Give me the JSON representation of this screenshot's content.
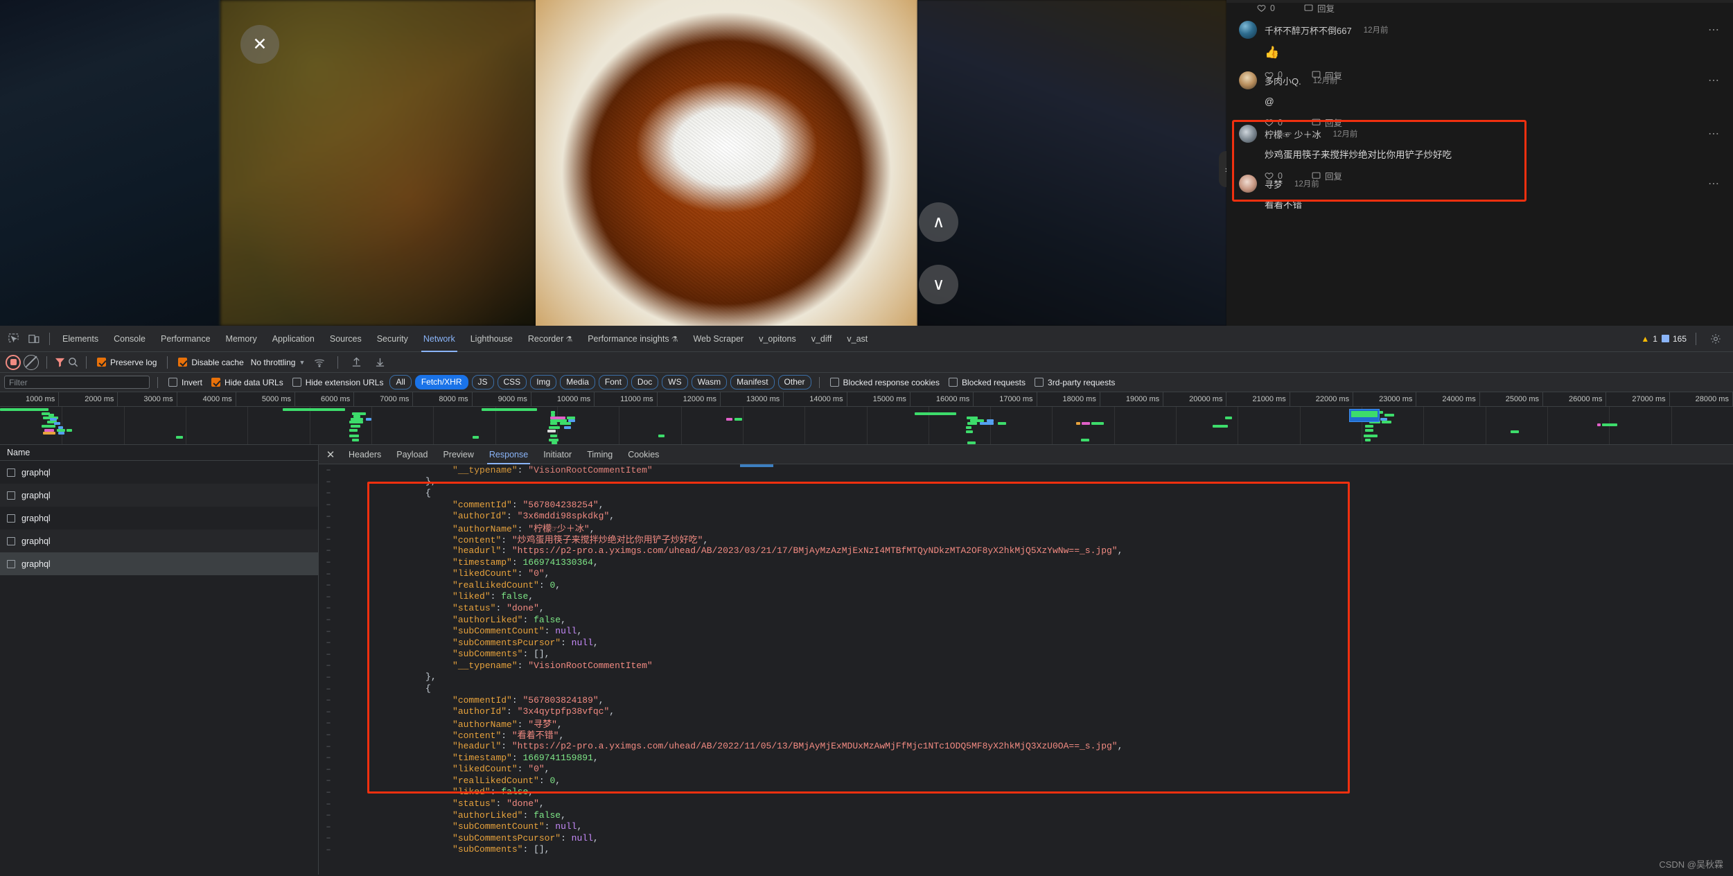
{
  "viewer": {
    "close_label": "✕",
    "prev_label": "∧",
    "next_label": "∨",
    "panel_toggle_label": "›"
  },
  "comments": {
    "items": [
      {
        "name": "",
        "time": "",
        "body": "",
        "likes": "0",
        "reply": "回复",
        "partial": true
      },
      {
        "name": "千杯不醉万杯不倒667",
        "time": "12月前",
        "body": "👍",
        "likes": "0",
        "reply": "回复",
        "more": "⋯"
      },
      {
        "name": "多肉小Q.",
        "time": "12月前",
        "body": "@",
        "likes": "0",
        "reply": "回复",
        "more": "⋯"
      },
      {
        "name": "柠檬☞ 少＋冰",
        "time": "12月前",
        "body": "炒鸡蛋用筷子来搅拌炒绝对比你用铲子炒好吃",
        "likes": "0",
        "reply": "回复",
        "more": "⋯"
      },
      {
        "name": "寻梦",
        "time": "12月前",
        "body": "看着不错",
        "likes": "",
        "reply": "",
        "more": "⋯"
      }
    ],
    "highlight_color": "#f0300f"
  },
  "devtools": {
    "tabs": [
      {
        "label": "Elements",
        "active": false
      },
      {
        "label": "Console",
        "active": false
      },
      {
        "label": "Performance",
        "active": false
      },
      {
        "label": "Memory",
        "active": false
      },
      {
        "label": "Application",
        "active": false
      },
      {
        "label": "Sources",
        "active": false
      },
      {
        "label": "Security",
        "active": false
      },
      {
        "label": "Network",
        "active": true
      },
      {
        "label": "Lighthouse",
        "active": false
      },
      {
        "label": "Recorder",
        "active": false,
        "flask": true
      },
      {
        "label": "Performance insights",
        "active": false,
        "flask": true
      },
      {
        "label": "Web Scraper",
        "active": false
      },
      {
        "label": "v_opitons",
        "active": false
      },
      {
        "label": "v_diff",
        "active": false
      },
      {
        "label": "v_ast",
        "active": false
      }
    ],
    "status": {
      "warning_count": "1",
      "message_count": "165"
    },
    "toolbar": {
      "preserve_log": "Preserve log",
      "preserve_log_checked": true,
      "disable_cache": "Disable cache",
      "disable_cache_checked": true,
      "throttling": "No throttling"
    },
    "filterbar": {
      "filter_placeholder": "Filter",
      "filter_value": "",
      "invert": "Invert",
      "invert_checked": false,
      "hide_data_urls": "Hide data URLs",
      "hide_data_urls_checked": true,
      "hide_extension_urls": "Hide extension URLs",
      "hide_extension_urls_checked": false,
      "types": [
        {
          "label": "All",
          "active": false
        },
        {
          "label": "Fetch/XHR",
          "active": true
        },
        {
          "label": "JS",
          "active": false
        },
        {
          "label": "CSS",
          "active": false
        },
        {
          "label": "Img",
          "active": false
        },
        {
          "label": "Media",
          "active": false
        },
        {
          "label": "Font",
          "active": false
        },
        {
          "label": "Doc",
          "active": false
        },
        {
          "label": "WS",
          "active": false
        },
        {
          "label": "Wasm",
          "active": false
        },
        {
          "label": "Manifest",
          "active": false
        },
        {
          "label": "Other",
          "active": false
        }
      ],
      "blocked_response_cookies": "Blocked response cookies",
      "blocked_response_cookies_checked": false,
      "blocked_requests": "Blocked requests",
      "blocked_requests_checked": false,
      "third_party_requests": "3rd-party requests",
      "third_party_requests_checked": false
    },
    "timeline": {
      "ticks": [
        "1000 ms",
        "2000 ms",
        "3000 ms",
        "4000 ms",
        "5000 ms",
        "6000 ms",
        "7000 ms",
        "8000 ms",
        "9000 ms",
        "10000 ms",
        "11000 ms",
        "12000 ms",
        "13000 ms",
        "14000 ms",
        "15000 ms",
        "16000 ms",
        "17000 ms",
        "18000 ms",
        "19000 ms",
        "20000 ms",
        "21000 ms",
        "22000 ms",
        "23000 ms",
        "24000 ms",
        "25000 ms",
        "26000 ms",
        "27000 ms",
        "28000 ms"
      ]
    },
    "requests": {
      "column_name": "Name",
      "rows": [
        {
          "name": "graphql",
          "selected": false
        },
        {
          "name": "graphql",
          "selected": false
        },
        {
          "name": "graphql",
          "selected": false
        },
        {
          "name": "graphql",
          "selected": false
        },
        {
          "name": "graphql",
          "selected": true
        }
      ]
    },
    "detail_tabs": [
      {
        "label": "Headers",
        "active": false
      },
      {
        "label": "Payload",
        "active": false
      },
      {
        "label": "Preview",
        "active": false
      },
      {
        "label": "Response",
        "active": true
      },
      {
        "label": "Initiator",
        "active": false
      },
      {
        "label": "Timing",
        "active": false
      },
      {
        "label": "Cookies",
        "active": false
      }
    ],
    "response_json": {
      "typename_value": "VisionRootCommentItem",
      "comment_1": {
        "commentId": "567804238254",
        "authorId": "3x6mddi98spkdkg",
        "authorName": "柠檬☞少＋冰",
        "content": "炒鸡蛋用筷子来搅拌炒绝对比你用铲子炒好吃",
        "headurl": "https://p2-pro.a.yximgs.com/uhead/AB/2023/03/21/17/BMjAyMzAzMjExNzI4MTBfMTQyNDkzMTA2OF8yX2hkMjQ5XzYwNw==_s.jpg",
        "timestamp": "1669741330364",
        "likedCount": "0",
        "realLikedCount": "0",
        "liked": "false",
        "status": "done",
        "authorLiked": "false",
        "subCommentCount": "null",
        "subCommentsPcursor": "null",
        "subComments": "[]",
        "__typename": "VisionRootCommentItem"
      },
      "comment_2": {
        "commentId": "567803824189",
        "authorId": "3x4qytpfp38vfqc",
        "authorName": "寻梦",
        "content": "看着不错",
        "headurl": "https://p2-pro.a.yximgs.com/uhead/AB/2022/11/05/13/BMjAyMjExMDUxMzAwMjFfMjc1NTc1ODQ5MF8yX2hkMjQ3XzU0OA==_s.jpg",
        "timestamp": "1669741159891",
        "likedCount": "0",
        "realLikedCount": "0",
        "liked": "false",
        "status": "done",
        "authorLiked": "false",
        "subCommentCount": "null",
        "subCommentsPcursor": "null",
        "subComments": "[]"
      }
    }
  },
  "watermark": "CSDN @吴秋霖"
}
